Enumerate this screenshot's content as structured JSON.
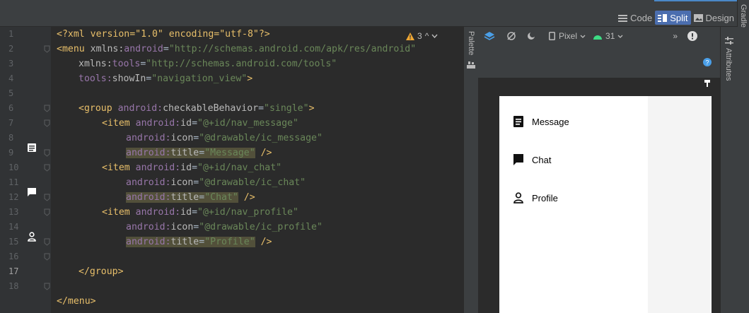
{
  "view_modes": {
    "code": "Code",
    "split": "Split",
    "design": "Design"
  },
  "side_tabs": {
    "gradle": "Gradle",
    "palette": "Palette",
    "attributes": "Attributes"
  },
  "warnings": {
    "count": "3"
  },
  "design_toolbar": {
    "device": "Pixel",
    "api": "31"
  },
  "line_numbers": [
    "1",
    "2",
    "3",
    "4",
    "5",
    "6",
    "7",
    "8",
    "9",
    "10",
    "11",
    "12",
    "13",
    "14",
    "15",
    "16",
    "17",
    "18"
  ],
  "code": {
    "l1": {
      "pi": "<?xml version=\"1.0\" encoding=\"utf-8\"?>"
    },
    "l2": {
      "open": "<menu ",
      "ns": "xmlns:",
      "attr": "android",
      "eq": "=",
      "val": "\"http://schemas.android.com/apk/res/android\""
    },
    "l3": {
      "ns": "xmlns:",
      "attr": "tools",
      "eq": "=",
      "val": "\"http://schemas.android.com/tools\""
    },
    "l4": {
      "ns": "tools:",
      "attr": "showIn",
      "eq": "=",
      "val": "\"navigation_view\"",
      "close": ">"
    },
    "l6": {
      "open": "<group ",
      "ns": "android:",
      "attr": "checkableBehavior",
      "eq": "=",
      "val": "\"single\"",
      "close": ">"
    },
    "l7": {
      "open": "<item ",
      "ns": "android:",
      "attr": "id",
      "eq": "=",
      "val": "\"@+id/nav_message\""
    },
    "l8": {
      "ns": "android:",
      "attr": "icon",
      "eq": "=",
      "val": "\"@drawable/ic_message\""
    },
    "l9": {
      "ns": "android:",
      "attr": "title",
      "eq": "=",
      "val": "\"Message\"",
      "close": " />"
    },
    "l10": {
      "open": "<item ",
      "ns": "android:",
      "attr": "id",
      "eq": "=",
      "val": "\"@+id/nav_chat\""
    },
    "l11": {
      "ns": "android:",
      "attr": "icon",
      "eq": "=",
      "val": "\"@drawable/ic_chat\""
    },
    "l12": {
      "ns": "android:",
      "attr": "title",
      "eq": "=",
      "val": "\"Chat\"",
      "close": " />"
    },
    "l13": {
      "open": "<item ",
      "ns": "android:",
      "attr": "id",
      "eq": "=",
      "val": "\"@+id/nav_profile\""
    },
    "l14": {
      "ns": "android:",
      "attr": "icon",
      "eq": "=",
      "val": "\"@drawable/ic_profile\""
    },
    "l15": {
      "ns": "android:",
      "attr": "title",
      "eq": "=",
      "val": "\"Profile\"",
      "close": " />"
    },
    "l16": {
      "text": "</group>"
    },
    "l18": {
      "text": "</menu>"
    }
  },
  "preview_menu": [
    {
      "label": "Message",
      "icon": "message-icon"
    },
    {
      "label": "Chat",
      "icon": "chat-icon"
    },
    {
      "label": "Profile",
      "icon": "profile-icon"
    }
  ],
  "colors": {
    "tag": "#e8bf6a",
    "namespace": "#9876aa",
    "value": "#6a8759",
    "accent": "#4b6eaf"
  }
}
